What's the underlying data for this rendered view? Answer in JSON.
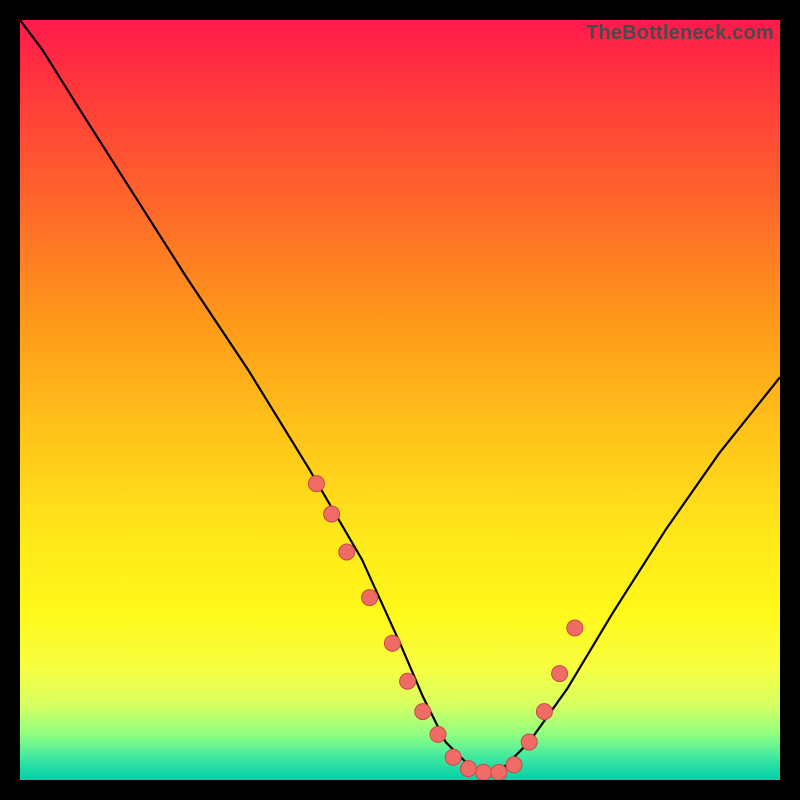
{
  "watermark": "TheBottleneck.com",
  "colors": {
    "background": "#000000",
    "curve": "#000000",
    "datapoint_fill": "#ef6b66",
    "datapoint_stroke": "#c94a45"
  },
  "chart_data": {
    "type": "line",
    "title": "",
    "xlabel": "",
    "ylabel": "",
    "xlim": [
      0,
      100
    ],
    "ylim": [
      0,
      100
    ],
    "grid": false,
    "legend": false,
    "series": [
      {
        "name": "bottleneck-curve",
        "x": [
          0,
          3,
          8,
          15,
          22,
          30,
          38,
          45,
          50,
          53,
          56,
          60,
          63,
          67,
          72,
          78,
          85,
          92,
          100
        ],
        "values": [
          100,
          96,
          88,
          77,
          66,
          54,
          41,
          29,
          18,
          11,
          5,
          1,
          1,
          5,
          12,
          22,
          33,
          43,
          53
        ]
      }
    ],
    "datapoints": {
      "name": "highlighted-points",
      "x": [
        39,
        41,
        43,
        46,
        49,
        51,
        53,
        55,
        57,
        59,
        61,
        63,
        65,
        67,
        69,
        71,
        73
      ],
      "values": [
        39,
        35,
        30,
        24,
        18,
        13,
        9,
        6,
        3,
        1.5,
        1,
        1,
        2,
        5,
        9,
        14,
        20
      ]
    }
  }
}
